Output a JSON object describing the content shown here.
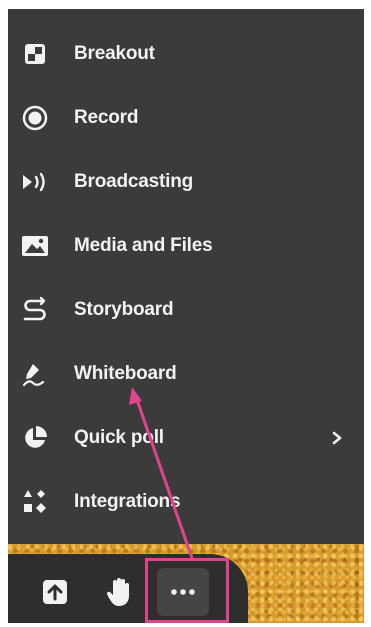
{
  "menu": {
    "items": [
      {
        "label": "Breakout",
        "icon": "breakout-icon"
      },
      {
        "label": "Record",
        "icon": "record-icon"
      },
      {
        "label": "Broadcasting",
        "icon": "broadcast-icon"
      },
      {
        "label": "Media and Files",
        "icon": "image-icon"
      },
      {
        "label": "Storyboard",
        "icon": "storyboard-icon"
      },
      {
        "label": "Whiteboard",
        "icon": "pen-icon"
      },
      {
        "label": "Quick poll",
        "icon": "pie-chart-icon",
        "has_submenu": true
      },
      {
        "label": "Integrations",
        "icon": "shapes-icon"
      }
    ]
  },
  "toolbar": {
    "buttons": [
      {
        "name": "share-screen",
        "icon": "upload-icon"
      },
      {
        "name": "raise-hand",
        "icon": "hand-icon"
      },
      {
        "name": "more-options",
        "icon": "ellipsis-icon"
      }
    ]
  },
  "colors": {
    "menu_background": "#3b3b3b",
    "text": "#f2f2f2",
    "annotation_pink": "#e0458c",
    "toolbar_background": "#2e2e2e"
  }
}
